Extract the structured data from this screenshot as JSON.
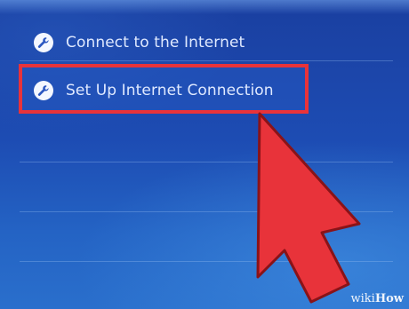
{
  "menu": {
    "items": [
      {
        "label": "Connect to the Internet",
        "icon": "wrench-icon"
      },
      {
        "label": "Set Up Internet Connection",
        "icon": "wrench-icon",
        "highlighted": true
      }
    ]
  },
  "annotation": {
    "highlight_color": "#e8333a",
    "cursor_color": "#e8333a"
  },
  "watermark": {
    "part1": "wiki",
    "part2": "How"
  },
  "colors": {
    "background": "#1d4cb3",
    "text": "#dfe9ff"
  }
}
